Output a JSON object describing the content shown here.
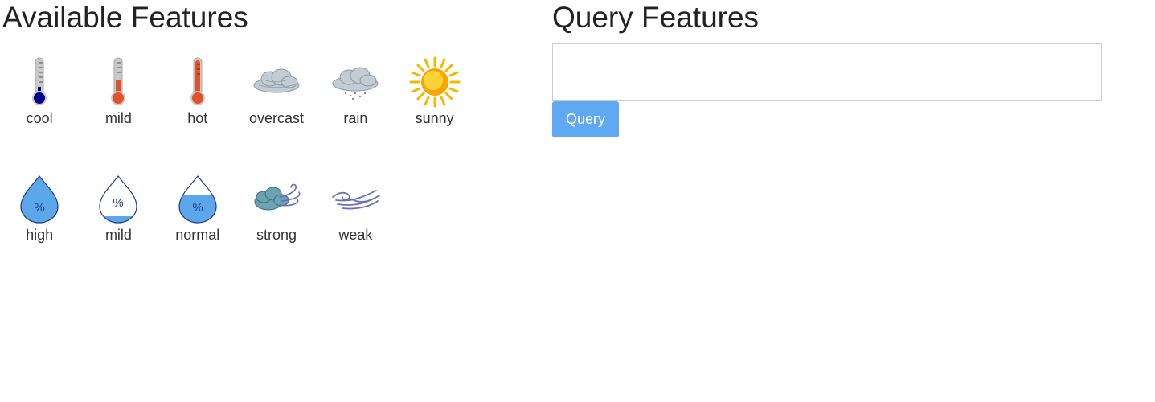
{
  "left": {
    "title": "Available Features",
    "row1": [
      {
        "label": "cool",
        "icon": "thermometer-cool-icon"
      },
      {
        "label": "mild",
        "icon": "thermometer-mild-icon"
      },
      {
        "label": "hot",
        "icon": "thermometer-hot-icon"
      },
      {
        "label": "overcast",
        "icon": "overcast-cloud-icon"
      },
      {
        "label": "rain",
        "icon": "rain-cloud-icon"
      },
      {
        "label": "sunny",
        "icon": "sun-icon"
      }
    ],
    "row2": [
      {
        "label": "high",
        "icon": "humidity-high-icon"
      },
      {
        "label": "mild",
        "icon": "humidity-mild-icon"
      },
      {
        "label": "normal",
        "icon": "humidity-normal-icon"
      },
      {
        "label": "strong",
        "icon": "wind-strong-icon"
      },
      {
        "label": "weak",
        "icon": "wind-weak-icon"
      }
    ]
  },
  "right": {
    "title": "Query Features",
    "query_button_label": "Query"
  },
  "colors": {
    "button": "#5fa8f3",
    "thermo_cool": "#00008b",
    "thermo_warm": "#e0522a",
    "drop_fill": "#5ba7ea",
    "drop_outline": "#1f3c88"
  }
}
